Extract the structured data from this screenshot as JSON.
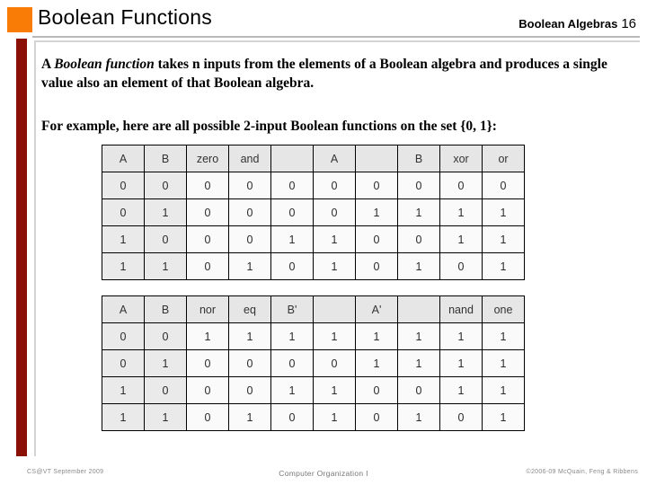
{
  "slide": {
    "title": "Boolean Functions",
    "header_right_label": "Boolean Algebras",
    "header_right_number": "16",
    "accent_orange": "#F97C07",
    "accent_red": "#8B1008"
  },
  "body": {
    "paragraph_1_prefix": "A ",
    "paragraph_1_italic": "Boolean function",
    "paragraph_1_rest": " takes n inputs from the elements of a Boolean algebra and produces a single value also an element of that Boolean algebra.",
    "paragraph_2": "For example, here are all possible 2-input Boolean functions on the set {0, 1}:"
  },
  "tables": [
    {
      "id": "table-upper",
      "headers": [
        "A",
        "B",
        "zero",
        "and",
        "",
        "A",
        "",
        "B",
        "xor",
        "or"
      ],
      "rows": [
        [
          "0",
          "0",
          "0",
          "0",
          "0",
          "0",
          "0",
          "0",
          "0",
          "0"
        ],
        [
          "0",
          "1",
          "0",
          "0",
          "0",
          "0",
          "1",
          "1",
          "1",
          "1"
        ],
        [
          "1",
          "0",
          "0",
          "0",
          "1",
          "1",
          "0",
          "0",
          "1",
          "1"
        ],
        [
          "1",
          "1",
          "0",
          "1",
          "0",
          "1",
          "0",
          "1",
          "0",
          "1"
        ]
      ]
    },
    {
      "id": "table-lower",
      "headers": [
        "A",
        "B",
        "nor",
        "eq",
        "B'",
        "",
        "A'",
        "",
        "nand",
        "one"
      ],
      "rows": [
        [
          "0",
          "0",
          "1",
          "1",
          "1",
          "1",
          "1",
          "1",
          "1",
          "1"
        ],
        [
          "0",
          "1",
          "0",
          "0",
          "0",
          "0",
          "1",
          "1",
          "1",
          "1"
        ],
        [
          "1",
          "0",
          "0",
          "0",
          "1",
          "1",
          "0",
          "0",
          "1",
          "1"
        ],
        [
          "1",
          "1",
          "0",
          "1",
          "0",
          "1",
          "0",
          "1",
          "0",
          "1"
        ]
      ]
    }
  ],
  "footer": {
    "left": "CS@VT September 2009",
    "center": "Computer Organization I",
    "right": "©2006-09 McQuain, Feng & Ribbens"
  }
}
